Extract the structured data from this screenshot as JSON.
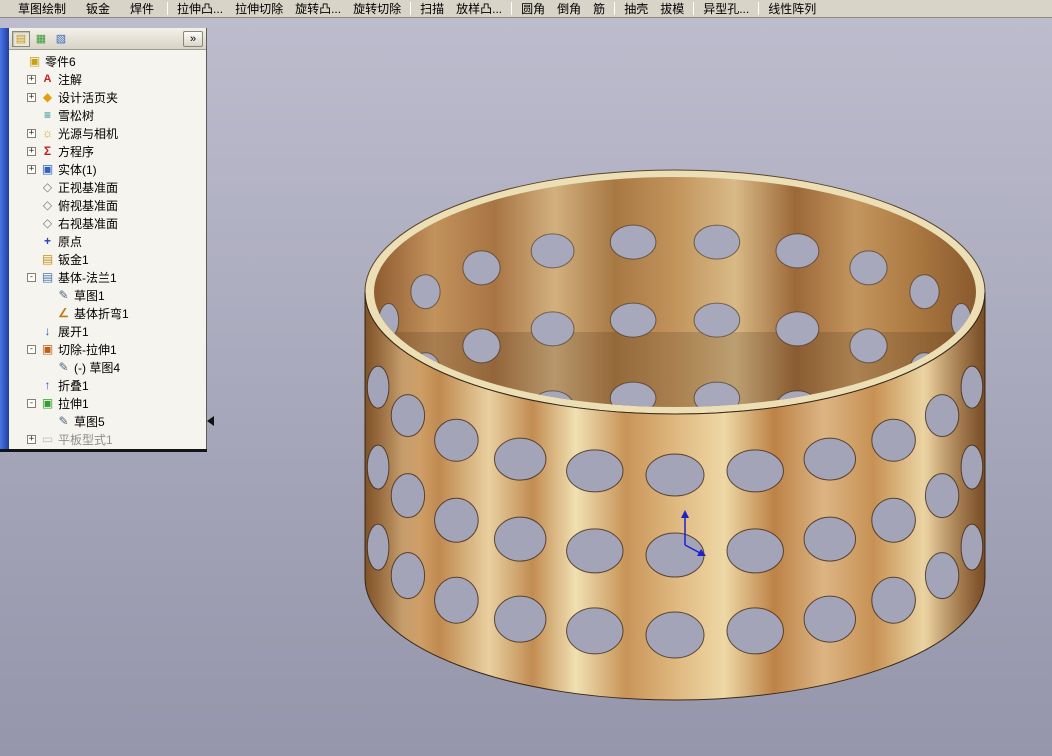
{
  "colors": {
    "viewport_bg_top": "#bcbccd",
    "viewport_bg_bottom": "#9595ab",
    "toolbar_bg": "#d8d4c8",
    "panel_bg": "#f6f4ee",
    "panel_accent_strip": "#2f5bd0",
    "rollback_bar": "#e6e600",
    "wood_light": "#e8d0a0",
    "wood_dark": "#a96e38",
    "origin_triad": "#2020cc"
  },
  "toolbar": {
    "tabs": [
      {
        "label": "草图绘制"
      },
      {
        "label": "钣金"
      },
      {
        "label": "焊件"
      }
    ],
    "groups": [
      {
        "items": [
          {
            "label": "拉伸凸..."
          },
          {
            "label": "拉伸切除"
          },
          {
            "label": "旋转凸..."
          },
          {
            "label": "旋转切除"
          }
        ]
      },
      {
        "items": [
          {
            "label": "扫描"
          },
          {
            "label": "放样凸..."
          }
        ]
      },
      {
        "items": [
          {
            "label": "圆角"
          },
          {
            "label": "倒角"
          },
          {
            "label": "筋"
          }
        ]
      },
      {
        "items": [
          {
            "label": "抽壳"
          },
          {
            "label": "拔模"
          }
        ]
      },
      {
        "items": [
          {
            "label": "异型孔..."
          }
        ]
      },
      {
        "items": [
          {
            "label": "线性阵列"
          }
        ]
      }
    ]
  },
  "tree": {
    "header": {
      "chevron": "»"
    },
    "items": [
      {
        "label": "零件6",
        "icon": "part",
        "level": 0
      },
      {
        "label": "注解",
        "icon": "annotations",
        "expand": "+",
        "level": 1
      },
      {
        "label": "设计活页夹",
        "icon": "design_binder",
        "expand": "+",
        "level": 1
      },
      {
        "label": "雪松树",
        "icon": "material",
        "level": 1
      },
      {
        "label": "光源与相机",
        "icon": "lights",
        "expand": "+",
        "level": 1
      },
      {
        "label": "方程序",
        "icon": "equations",
        "expand": "+",
        "level": 1
      },
      {
        "label": "实体(1)",
        "icon": "solid_bodies",
        "expand": "+",
        "level": 1
      },
      {
        "label": "正视基准面",
        "icon": "plane",
        "level": 1
      },
      {
        "label": "俯视基准面",
        "icon": "plane",
        "level": 1
      },
      {
        "label": "右视基准面",
        "icon": "plane",
        "level": 1
      },
      {
        "label": "原点",
        "icon": "origin",
        "level": 1
      },
      {
        "label": "钣金1",
        "icon": "sheet_metal",
        "level": 1
      },
      {
        "label": "基体-法兰1",
        "icon": "base_flange",
        "expand": "-",
        "level": 1
      },
      {
        "label": "草图1",
        "icon": "sketch",
        "level": 2
      },
      {
        "label": "基体折弯1",
        "icon": "bend",
        "level": 2
      },
      {
        "label": "展开1",
        "icon": "unfold",
        "level": 1
      },
      {
        "label": "切除-拉伸1",
        "icon": "cut_extrude",
        "expand": "-",
        "level": 1
      },
      {
        "label": "(-) 草图4",
        "icon": "sketch",
        "level": 2
      },
      {
        "label": "折叠1",
        "icon": "fold",
        "level": 1
      },
      {
        "label": "拉伸1",
        "icon": "extrude",
        "expand": "-",
        "level": 1
      },
      {
        "label": "草图5",
        "icon": "sketch",
        "level": 2
      },
      {
        "label": "平板型式1",
        "icon": "flat_pattern",
        "expand": "+",
        "level": 1,
        "grayed": true
      }
    ]
  },
  "icons": {
    "part": "▣",
    "annotations": "A",
    "design_binder": "◆",
    "material": "≡",
    "lights": "☼",
    "equations": "Σ",
    "solid_bodies": "▣",
    "plane": "◇",
    "origin": "+",
    "sheet_metal": "▤",
    "base_flange": "▤",
    "sketch": "✎",
    "bend": "∠",
    "unfold": "↓",
    "cut_extrude": "▣",
    "fold": "↑",
    "extrude": "▣",
    "flat_pattern": "▭",
    "fm_tab": "▤",
    "pm_tab": "▦",
    "cm_tab": "▧"
  }
}
